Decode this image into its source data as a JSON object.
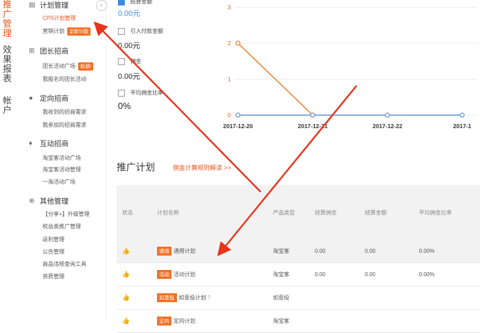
{
  "left_nav": [
    {
      "label": "推广管理",
      "active": true
    },
    {
      "label": "效果报表",
      "active": false
    },
    {
      "label": "帐户",
      "active": false
    }
  ],
  "sidebar": {
    "collapse_glyph": "‹",
    "sections": [
      {
        "title": "计划管理",
        "icon": "document-icon",
        "glyph": "▤",
        "items": [
          {
            "label": "CPS计划管理",
            "active": true
          },
          {
            "label": "营销计划",
            "tag": "定新功能"
          }
        ]
      },
      {
        "title": "团长招商",
        "icon": "grid-icon",
        "glyph": "⊞",
        "items": [
          {
            "label": "团长活动广场",
            "tag": "新朋!"
          },
          {
            "label": "我报名的团长活动"
          }
        ]
      },
      {
        "title": "定向招商",
        "icon": "location-pin-icon",
        "glyph": "●",
        "items": [
          {
            "label": "我收到的招商需求"
          },
          {
            "label": "我参加的招商需求"
          }
        ]
      },
      {
        "title": "互动招商",
        "icon": "brush-icon",
        "glyph": "♦",
        "items": [
          {
            "label": "淘宝客活动广场"
          },
          {
            "label": "淘宝客活动管理"
          },
          {
            "label": "一淘活动广场"
          }
        ]
      },
      {
        "title": "其他管理",
        "icon": "plus-circle-icon",
        "glyph": "⊕",
        "items": [
          {
            "label": "【分享+】升级管理"
          },
          {
            "label": "权益类推广管理"
          },
          {
            "label": "返利管理"
          },
          {
            "label": "公告管理"
          },
          {
            "label": "商品违规查询工具"
          },
          {
            "label": "资质管理"
          }
        ]
      }
    ]
  },
  "metrics": [
    {
      "label": "结算金额",
      "value": "0.00元",
      "checked": true
    },
    {
      "label": "引入付款金额",
      "value": "0.00元",
      "checked": false
    },
    {
      "label": "佣金",
      "value": "0.00元",
      "checked": false
    },
    {
      "label": "平均佣金比率",
      "value": "0%",
      "checked": false
    }
  ],
  "chart_data": {
    "type": "line",
    "x": [
      "2017-12-20",
      "2017-12-21",
      "2017-12-22",
      "2017-1"
    ],
    "y_ticks": [
      0,
      1,
      2,
      3
    ],
    "ylim": [
      0,
      3.2
    ],
    "series": [
      {
        "values": [
          2,
          0,
          null,
          null
        ],
        "color": "#f07a26"
      },
      {
        "values": [
          0,
          0,
          0,
          0
        ],
        "color": "#5b8fd4"
      }
    ]
  },
  "plans": {
    "title": "推广计划",
    "rule_link": "佣金计算规则解读 >>",
    "columns": [
      "状态",
      "计划名称",
      "产品类型",
      "结算佣金",
      "结算金额",
      "平均佣金比率"
    ],
    "rows": [
      {
        "tag": "通用",
        "name": "通用计划",
        "type": "淘宝客",
        "commission": "0.00",
        "amount": "0.00",
        "rate": "0.00%"
      },
      {
        "tag": "活动",
        "name": "活动计划",
        "type": "淘宝客",
        "commission": "0.00",
        "amount": "0.00",
        "rate": "0.00%"
      },
      {
        "tag": "如意投",
        "name": "如意投计划",
        "type": "如意投",
        "commission": "",
        "amount": "",
        "rate": ""
      },
      {
        "tag": "定向",
        "name": "定向计划",
        "type": "淘宝客",
        "commission": "",
        "amount": "",
        "rate": ""
      }
    ]
  },
  "annotation_color": "#e8341c"
}
